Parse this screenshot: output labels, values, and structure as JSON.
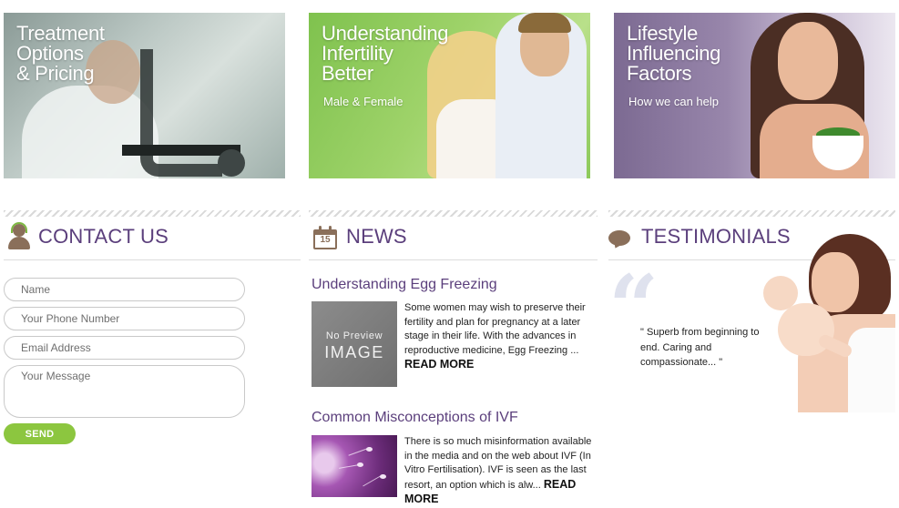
{
  "banners": [
    {
      "title": "Treatment\nOptions\n& Pricing",
      "subtitle": ""
    },
    {
      "title": "Understanding\nInfertility\nBetter",
      "subtitle": "Male & Female"
    },
    {
      "title": "Lifestyle\nInfluencing\nFactors",
      "subtitle": "How we can help"
    }
  ],
  "contact": {
    "title": "CONTACT US",
    "fields": {
      "name_placeholder": "Name",
      "phone_placeholder": "Your Phone Number",
      "email_placeholder": "Email Address",
      "message_placeholder": "Your Message"
    },
    "send_label": "SEND"
  },
  "news": {
    "title": "NEWS",
    "calendar_day": "15",
    "items": [
      {
        "title": "Understanding Egg Freezing",
        "thumb_line1": "No Preview",
        "thumb_line2": "IMAGE",
        "excerpt": "Some women may wish to preserve their fertility and plan for pregnancy at a later stage in their life. With the advances in reproductive medicine, Egg Freezing ...",
        "read_more": "READ MORE"
      },
      {
        "title": "Common Misconceptions of IVF",
        "excerpt": "There is so much misinformation available in the media and on the web about IVF (In Vitro Fertilisation). IVF is seen as the last resort, an option which is alw...",
        "read_more": "READ MORE"
      }
    ]
  },
  "testimonials": {
    "title": "TESTIMONIALS",
    "quote_mark": "“",
    "quote": "\" Superb from beginning to end. Caring and compassionate... \""
  },
  "colors": {
    "accent_purple": "#5b3f7c",
    "send_green": "#8cc63f",
    "icon_brown": "#8a6f5a"
  }
}
